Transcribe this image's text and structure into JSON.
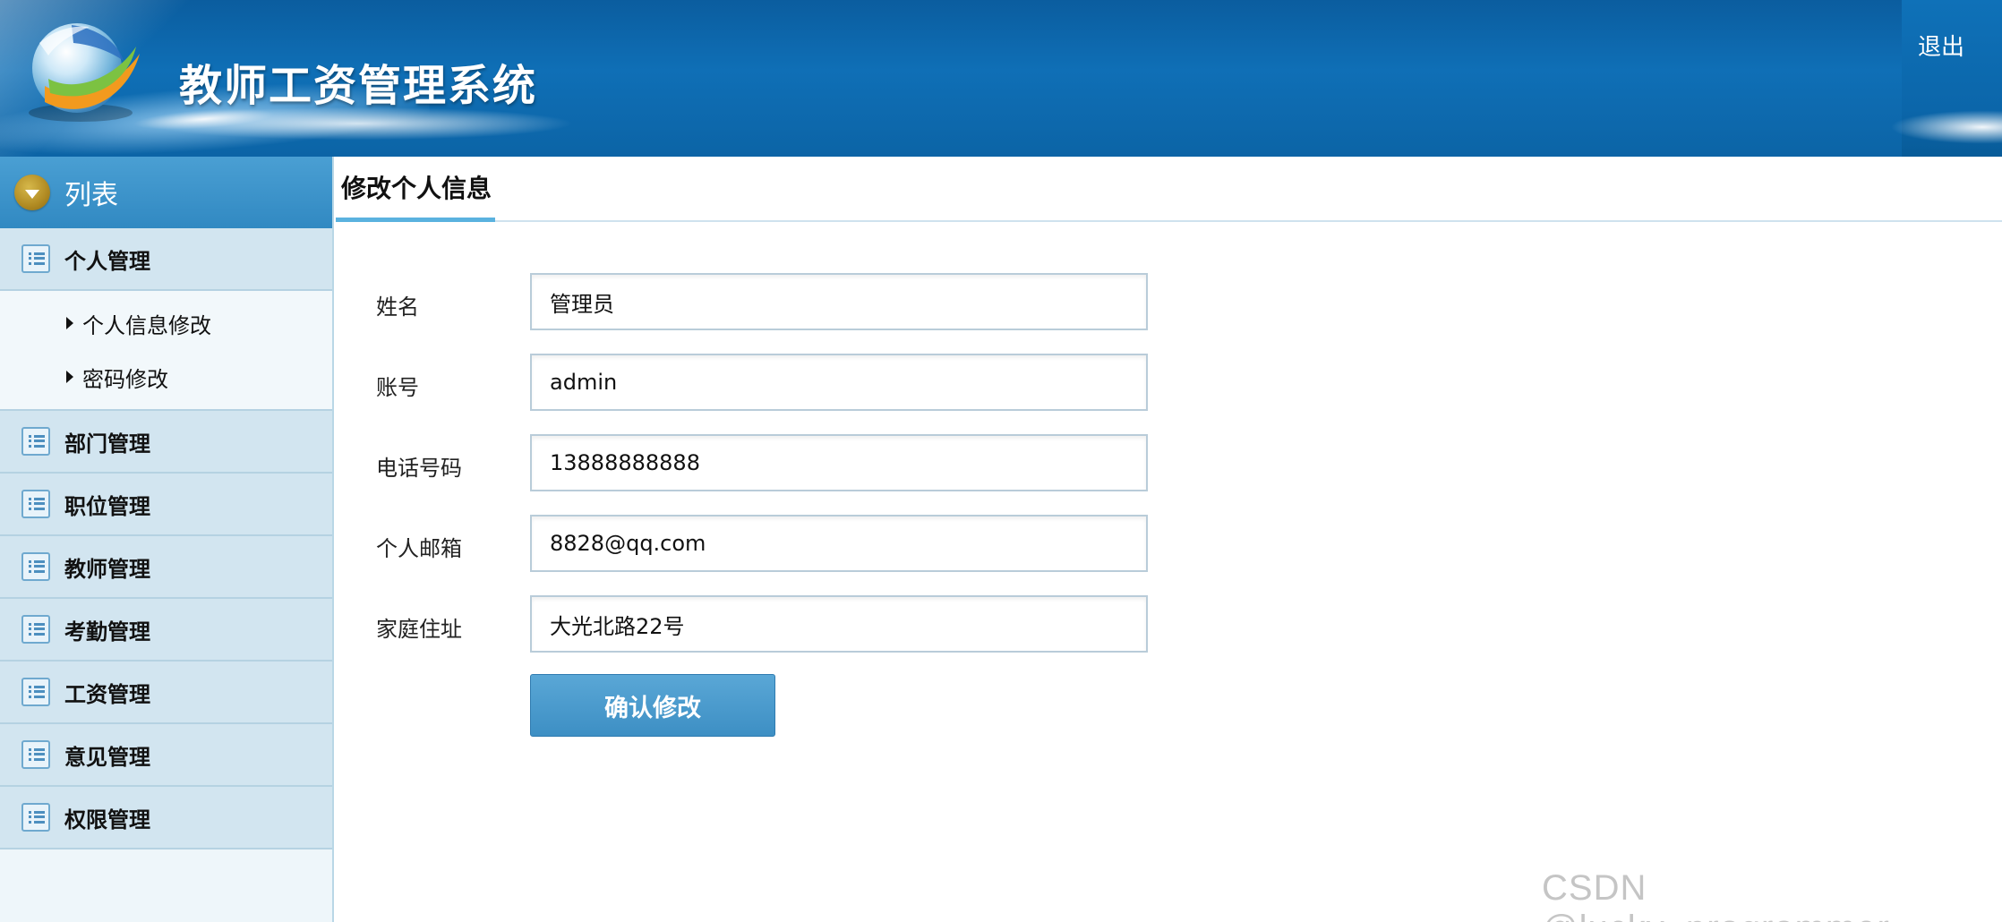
{
  "header": {
    "system_title": "教师工资管理系统",
    "logout_label": "退出"
  },
  "sidebar": {
    "head_label": "列表",
    "groups": [
      {
        "label": "个人管理",
        "expanded": true,
        "sub_items": [
          "个人信息修改",
          "密码修改"
        ]
      },
      {
        "label": "部门管理"
      },
      {
        "label": "职位管理"
      },
      {
        "label": "教师管理"
      },
      {
        "label": "考勤管理"
      },
      {
        "label": "工资管理"
      },
      {
        "label": "意见管理"
      },
      {
        "label": "权限管理"
      }
    ]
  },
  "main": {
    "tab_label": "修改个人信息",
    "form": {
      "fields": [
        {
          "label": "姓名",
          "value": "管理员"
        },
        {
          "label": "账号",
          "value": "admin"
        },
        {
          "label": "电话号码",
          "value": "13888888888"
        },
        {
          "label": "个人邮箱",
          "value": "8828@qq.com"
        },
        {
          "label": "家庭住址",
          "value": "大光北路22号"
        }
      ],
      "submit_label": "确认修改"
    }
  },
  "watermark": "CSDN @lucky_programmer",
  "colors": {
    "header_blue": "#0f6fb6",
    "sidebar_head": "#3189c2",
    "menu_group_bg": "#d2e5f0",
    "tab_underline": "#5ab2df",
    "button_blue": "#3d8fc4"
  }
}
